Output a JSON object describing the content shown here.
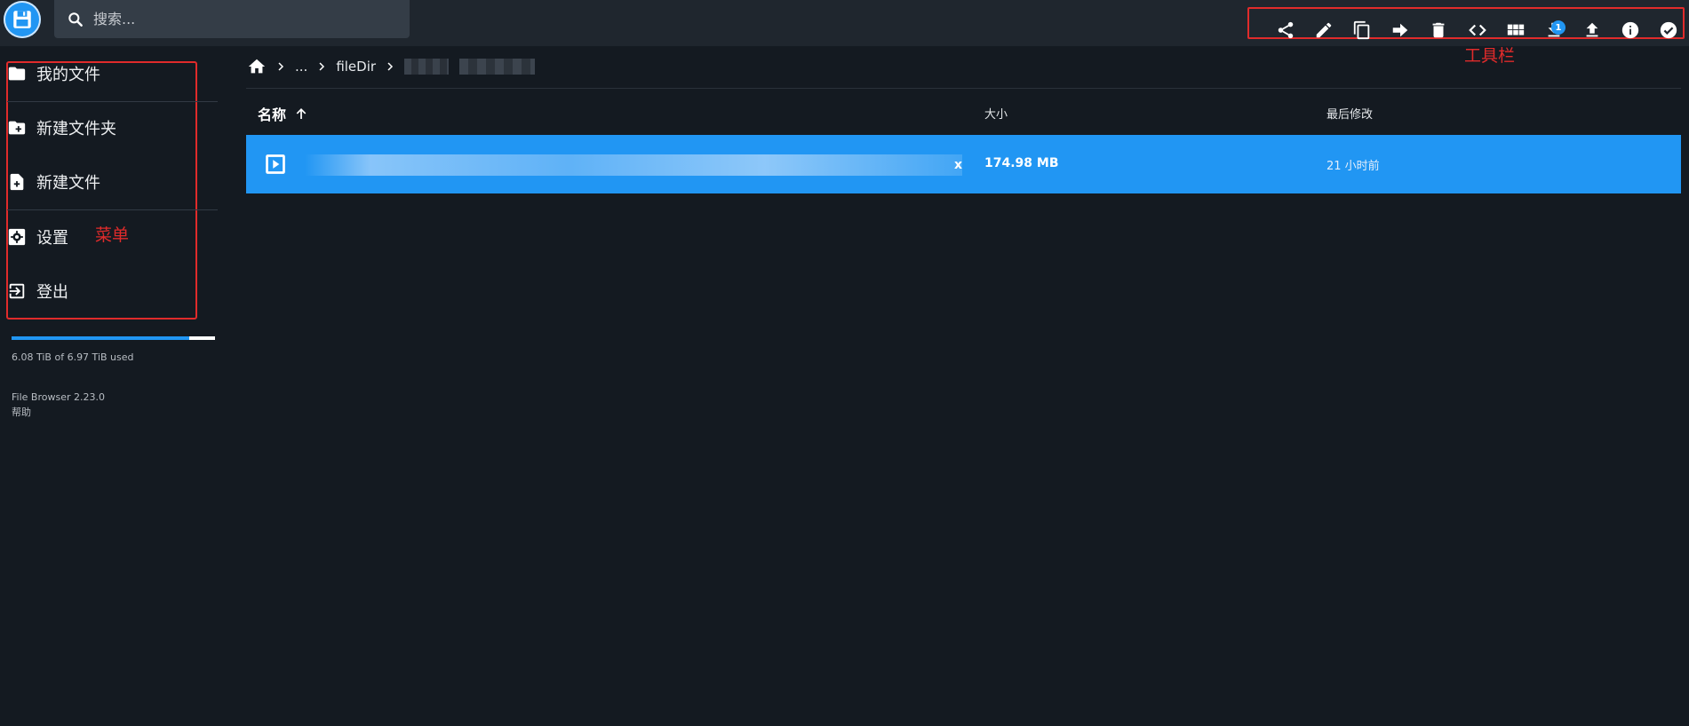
{
  "header": {
    "search_placeholder": "搜索..."
  },
  "toolbar": {
    "icons": [
      "share-icon",
      "edit-icon",
      "copy-icon",
      "move-icon",
      "delete-icon",
      "embed-icon",
      "grid-view-icon",
      "download-icon",
      "upload-icon",
      "info-icon",
      "select-all-icon"
    ],
    "download_badge": "1",
    "annotation": "工具栏"
  },
  "sidebar": {
    "items": [
      {
        "label": "我的文件",
        "icon": "folder-icon"
      },
      {
        "label": "新建文件夹",
        "icon": "new-folder-icon"
      },
      {
        "label": "新建文件",
        "icon": "new-file-icon"
      },
      {
        "label": "设置",
        "icon": "settings-icon"
      },
      {
        "label": "登出",
        "icon": "logout-icon"
      }
    ],
    "annotation": "菜单",
    "usage_fraction": 0.872,
    "usage_text": "6.08 TiB of 6.97 TiB used",
    "version": "File Browser 2.23.0",
    "help": "帮助"
  },
  "breadcrumb": {
    "items": [
      "...",
      "fileDir"
    ]
  },
  "list": {
    "columns": {
      "name": "名称",
      "size": "大小",
      "modified": "最后修改"
    },
    "rows": [
      {
        "name_tail": "x",
        "size": "174.98 MB",
        "modified": "21 小时前",
        "selected": true
      }
    ]
  },
  "colors": {
    "accent": "#2196f3",
    "background": "#141a21",
    "header": "#1f262e",
    "annotation": "#e02b2b"
  }
}
